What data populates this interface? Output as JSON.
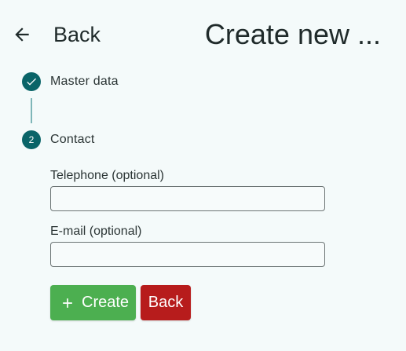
{
  "header": {
    "back_label": "Back",
    "title": "Create new ..."
  },
  "stepper": {
    "steps": [
      {
        "label": "Master data",
        "state": "completed",
        "icon": "check-icon"
      },
      {
        "label": "Contact",
        "state": "active",
        "number": "2"
      }
    ]
  },
  "form": {
    "telephone": {
      "label": "Telephone (optional)",
      "value": "",
      "placeholder": ""
    },
    "email": {
      "label": "E-mail (optional)",
      "value": "",
      "placeholder": ""
    }
  },
  "actions": {
    "create_label": "Create",
    "back_label": "Back"
  },
  "colors": {
    "background": "#f4fafa",
    "step_accent": "#0a6468",
    "create_button": "#4caf50",
    "back_button": "#b71c1c"
  }
}
